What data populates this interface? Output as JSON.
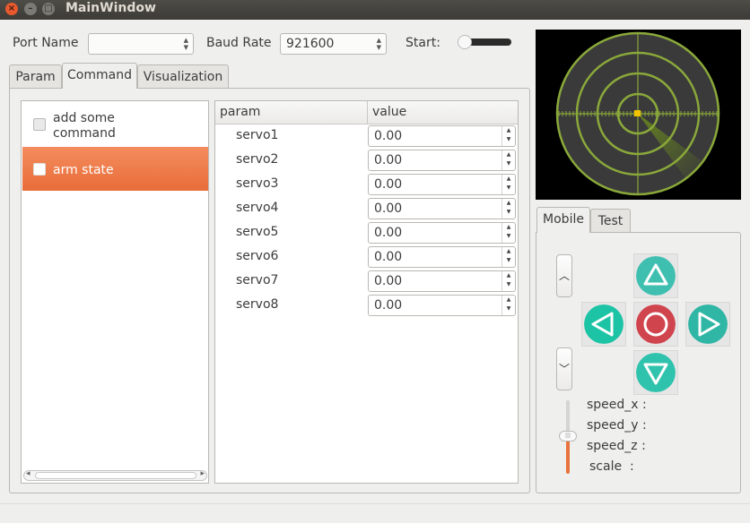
{
  "window": {
    "title": "MainWindow",
    "close_glyph": "×",
    "min_glyph": "–",
    "max_glyph": "□"
  },
  "top_bar": {
    "port_label": "Port Name",
    "port_value": "",
    "baud_label": "Baud Rate",
    "baud_value": "921600",
    "start_label": "Start:",
    "start_toggle_on": false
  },
  "tabs": [
    {
      "label": "Param",
      "active": false
    },
    {
      "label": "Command",
      "active": true
    },
    {
      "label": "Visualization",
      "active": false
    }
  ],
  "commands": [
    {
      "label": "add some command",
      "checked": false,
      "selected": false
    },
    {
      "label": "arm state",
      "checked": false,
      "selected": true
    }
  ],
  "table": {
    "headers": [
      "param",
      "value"
    ],
    "rows": [
      {
        "name": "servo1",
        "value": "0.00"
      },
      {
        "name": "servo2",
        "value": "0.00"
      },
      {
        "name": "servo3",
        "value": "0.00"
      },
      {
        "name": "servo4",
        "value": "0.00"
      },
      {
        "name": "servo5",
        "value": "0.00"
      },
      {
        "name": "servo6",
        "value": "0.00"
      },
      {
        "name": "servo7",
        "value": "0.00"
      },
      {
        "name": "servo8",
        "value": "0.00"
      }
    ]
  },
  "radar": {
    "background": "#000000",
    "ring_color": "#8aa83a",
    "target_color": "#f2c200"
  },
  "control_tabs": [
    {
      "label": "Mobile",
      "active": true
    },
    {
      "label": "Test",
      "active": false
    }
  ],
  "controls": {
    "up_icon": "chevron-up-icon",
    "down_icon": "chevron-down-icon",
    "up_glyph": "︿",
    "down_glyph": "﹀",
    "forward_color": "#3fbfb0",
    "left_color": "#1cc4a5",
    "stop_color": "#d0444e",
    "right_color": "#2fb6a5",
    "back_color": "#2fc3ad"
  },
  "speed": {
    "labels": [
      "speed_x :",
      "speed_y :",
      "speed_z :",
      "scale  :"
    ],
    "slider_level": 0.5,
    "slider_color": "#e8733e"
  }
}
